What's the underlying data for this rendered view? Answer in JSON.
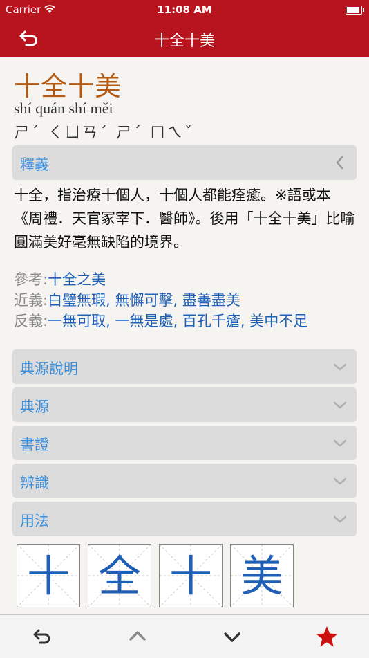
{
  "status": {
    "carrier": "Carrier",
    "time": "11:08 AM"
  },
  "nav": {
    "title": "十全十美"
  },
  "entry": {
    "headword": "十全十美",
    "pinyin": "shí quán shí měi",
    "zhuyin": "ㄕˊ ㄑㄩㄢˊ ㄕˊ ㄇㄟˇ",
    "sections": {
      "meaning": "釋義",
      "source_note": "典源說明",
      "source": "典源",
      "citations": "書證",
      "distinction": "辨識",
      "usage": "用法"
    },
    "definition": "十全，指治療十個人，十個人都能痊癒。※語或本《周禮．天官冢宰下．醫師》。後用「十全十美」比喻圓滿美好毫無缺陷的境界。",
    "refs": {
      "reference_label": "參考:",
      "reference": [
        "十全之美"
      ],
      "synonym_label": "近義:",
      "synonyms": [
        "白璧無瑕",
        "無懈可擊",
        "盡善盡美"
      ],
      "antonym_label": "反義:",
      "antonyms": [
        "一無可取",
        "一無是處",
        "百孔千瘡",
        "美中不足"
      ],
      "separator": ","
    },
    "characters": [
      "十",
      "全",
      "十",
      "美"
    ]
  },
  "colors": {
    "bar": "#b8141e",
    "link": "#1f5fb5",
    "section_text": "#3b8fdc",
    "headword": "#b45a12",
    "star": "#cc1111"
  },
  "tabs": [
    "back-icon",
    "chevron-up-icon",
    "chevron-down-icon",
    "star-icon"
  ]
}
